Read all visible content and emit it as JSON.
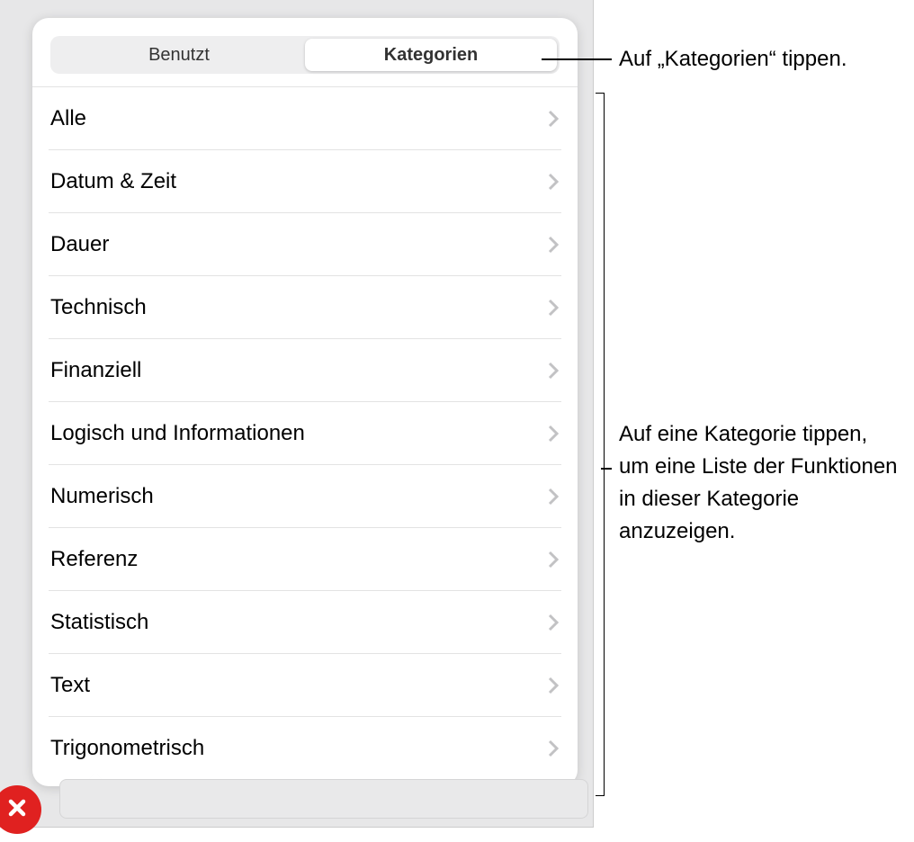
{
  "tabs": {
    "recent": "Benutzt",
    "categories": "Kategorien"
  },
  "categories": [
    "Alle",
    "Datum & Zeit",
    "Dauer",
    "Technisch",
    "Finanziell",
    "Logisch und Informationen",
    "Numerisch",
    "Referenz",
    "Statistisch",
    "Text",
    "Trigonometrisch"
  ],
  "callouts": {
    "tap_categories": "Auf „Kategorien“ tippen.",
    "tap_category_list": "Auf eine Kategorie tippen, um eine Liste der Funktionen in dieser Kategorie anzuzeigen."
  }
}
